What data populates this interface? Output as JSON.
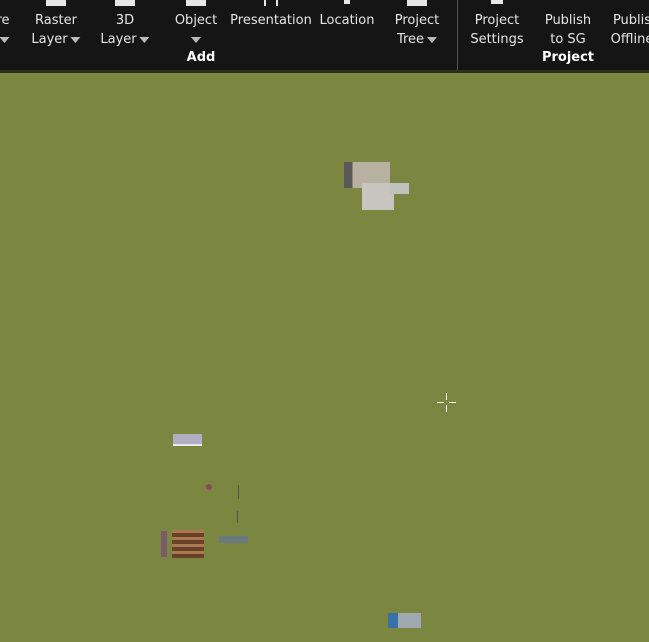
{
  "toolbar": {
    "buttons": [
      {
        "line1": "re",
        "line2": "",
        "caret": true
      },
      {
        "line1": "Raster",
        "line2": "Layer",
        "caret": true
      },
      {
        "line1": "3D",
        "line2": "Layer",
        "caret": true
      },
      {
        "line1": "Object",
        "line2": "",
        "caret": true
      },
      {
        "line1": "Presentation",
        "line2": "",
        "caret": false
      },
      {
        "line1": "Location",
        "line2": "",
        "caret": false
      },
      {
        "line1": "Project",
        "line2": "Tree",
        "caret": true
      },
      {
        "line1": "Project",
        "line2": "Settings",
        "caret": false
      },
      {
        "line1": "Publish",
        "line2": "to SG",
        "caret": false
      },
      {
        "line1": "Publis",
        "line2": "Offline",
        "caret": false
      }
    ],
    "groups": {
      "add": "Add",
      "project": "Project"
    }
  },
  "viewport": {
    "background": "#7b8641",
    "cursor_icon": "crosshair-icon"
  }
}
